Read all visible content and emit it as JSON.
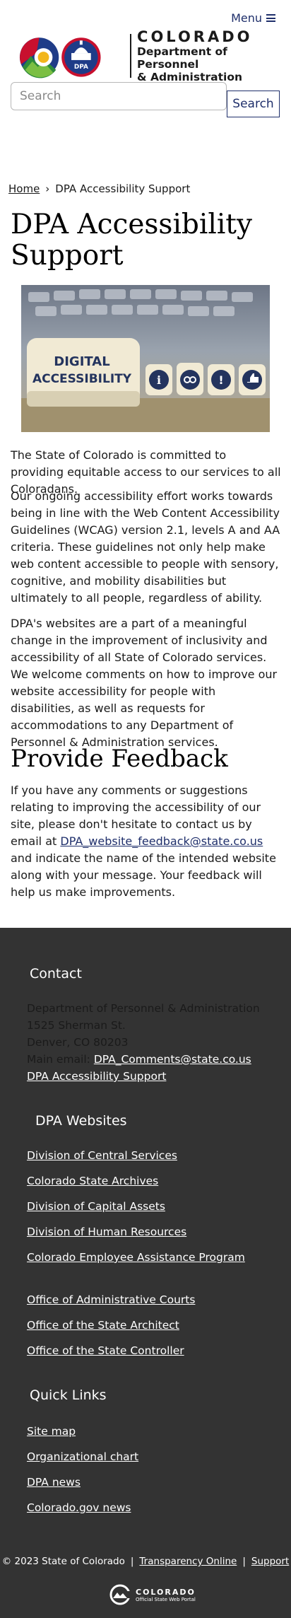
{
  "header": {
    "menu_label": "Menu",
    "logo_state": "COLORADO",
    "logo_dept_line1": "Department of Personnel",
    "logo_dept_line2": "& Administration",
    "seal_text": "DPA"
  },
  "search": {
    "placeholder": "Search",
    "button_label": "Search"
  },
  "breadcrumb": {
    "home": "Home",
    "separator": "›",
    "current": "DPA Accessibility Support"
  },
  "page": {
    "title": "DPA Accessibility Support",
    "hero_image": {
      "label_line1": "DIGITAL",
      "label_line2": "ACCESSIBILITY",
      "glyphs": [
        "i",
        "ℹ",
        "!",
        "👍"
      ]
    },
    "para1": "The State of Colorado is committed to providing equitable access to our services to all Coloradans.",
    "para2": "Our ongoing accessibility effort works towards being in line with the Web Content Accessibility Guidelines (WCAG) version 2.1, levels A and AA criteria. These guidelines not only help make web content accessible to people with sensory, cognitive, and mobility disabilities but ultimately to all people, regardless of ability.",
    "para3": "DPA's websites are a part of a meaningful change in the improvement of inclusivity and accessibility of all State of Colorado services. We welcome comments on how to improve our website accessibility for people with disabilities, as well as requests for accommodations to any Department of Personnel & Administration services.",
    "feedback_title": "Provide Feedback",
    "feedback_before": "If you have any comments or suggestions relating to improving the accessibility of our site, please don't hesitate to contact us by email at",
    "feedback_email": "DPA_website_feedback@state.co.us",
    "feedback_after": "and indicate the name of the intended website along with your message. Your feedback will help us make improvements."
  },
  "footer": {
    "contact_heading": "Contact",
    "org_name": "Department of Personnel & Administration",
    "address1": "1525 Sherman St.",
    "address2": "Denver, CO 80203",
    "email_label": "Main email:",
    "email": "DPA_Comments@state.co.us",
    "accessibility_link": "DPA Accessibility Support",
    "websites_heading": "DPA Websites",
    "websites_group1": [
      "Division of Central Services",
      "Colorado State Archives",
      "Division of Capital Assets",
      "Division of Human Resources",
      "Colorado Employee Assistance Program"
    ],
    "websites_group2": [
      "Office of Administrative Courts",
      "Office of the State Architect",
      "Office of the State Controller"
    ],
    "quicklinks_heading": "Quick Links",
    "quicklinks": [
      "Site map",
      "Organizational chart",
      "DPA news",
      "Colorado.gov news"
    ],
    "copyright": "© 2023 State of Colorado",
    "sep": "|",
    "transparency": "Transparency Online",
    "support": "Support",
    "portal_name": "COLORADO",
    "portal_sub": "Official State Web Portal"
  },
  "colors": {
    "brand_navy": "#1f2f6b",
    "footer_bg": "#333333",
    "co_red": "#c8102e",
    "co_blue": "#1f3c88",
    "co_gold": "#f2b61b"
  }
}
